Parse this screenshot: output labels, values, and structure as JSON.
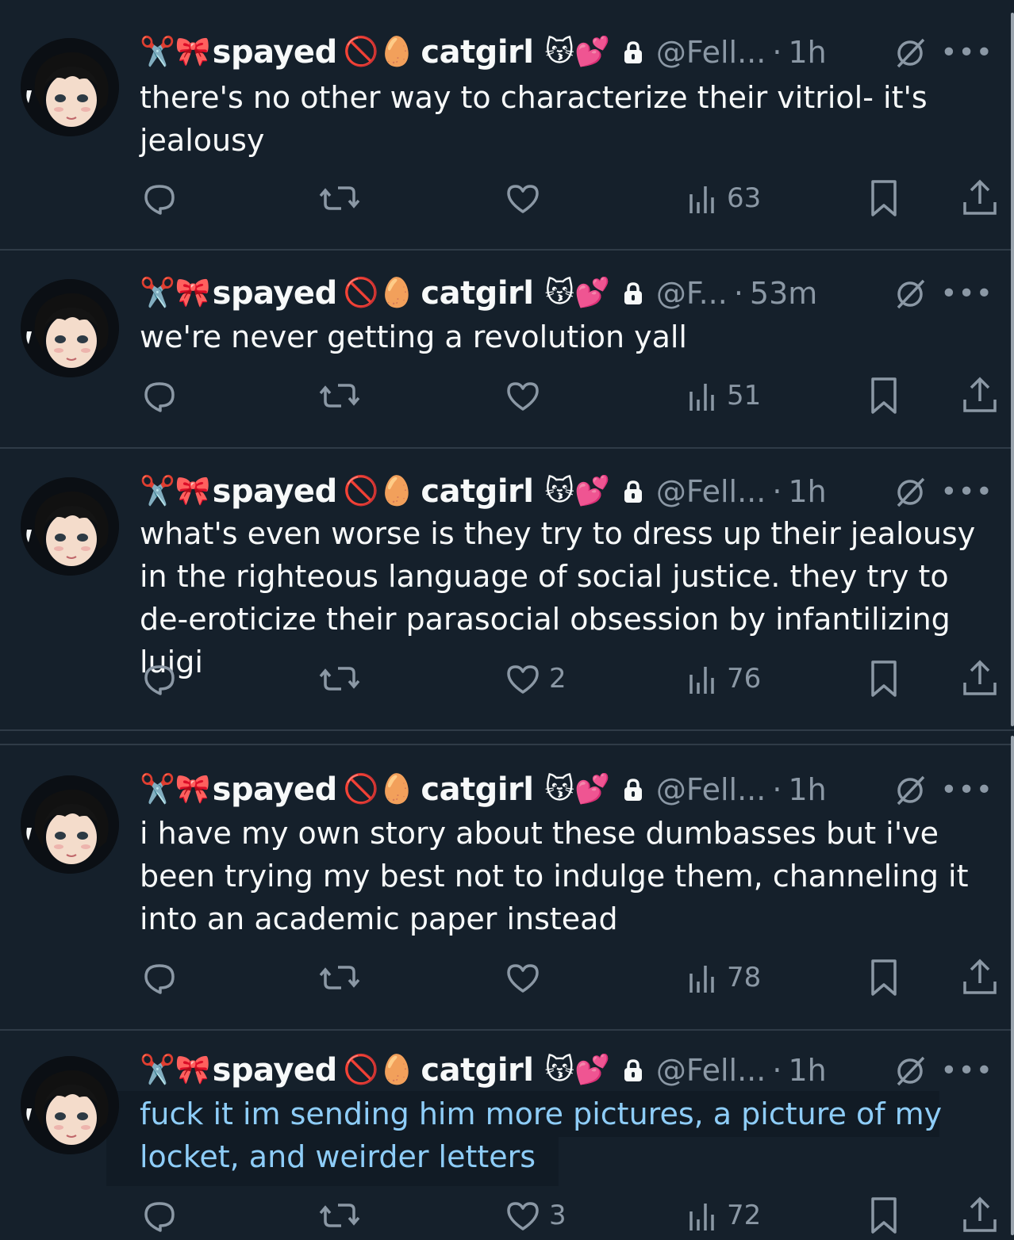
{
  "colors": {
    "background": "#15202b",
    "text": "#f7f9f9",
    "muted": "#8b98a5",
    "highlight_text": "#8ecdf8",
    "divider": "#2f3b47"
  },
  "tweets": [
    {
      "prefix_emoji": "✂️🎀",
      "name_part1": "spayed",
      "mid_emoji": "🚫🥚",
      "name_part2": "catgirl",
      "suffix_emoji": "😽💕",
      "handle": "@Fell...",
      "dot": "·",
      "time": "1h",
      "text": "there's no other way to characterize their vitriol- it's jealousy",
      "highlighted": false,
      "replies": "",
      "retweets": "",
      "likes": "",
      "views": "63"
    },
    {
      "prefix_emoji": "✂️🎀",
      "name_part1": "spayed",
      "mid_emoji": "🚫🥚",
      "name_part2": "catgirl",
      "suffix_emoji": "😽💕",
      "handle": "@F...",
      "dot": "·",
      "time": "53m",
      "text": "we're never getting a revolution yall",
      "highlighted": false,
      "replies": "",
      "retweets": "",
      "likes": "",
      "views": "51"
    },
    {
      "prefix_emoji": "✂️🎀",
      "name_part1": "spayed",
      "mid_emoji": "🚫🥚",
      "name_part2": "catgirl",
      "suffix_emoji": "😽💕",
      "handle": "@Fell...",
      "dot": "·",
      "time": "1h",
      "text": "what's even worse is they try to dress up their jealousy in the righteous language of social justice. they try to de-eroticize their parasocial obsession by infantilizing luigi",
      "highlighted": false,
      "replies": "",
      "retweets": "",
      "likes": "2",
      "views": "76"
    },
    {
      "prefix_emoji": "✂️🎀",
      "name_part1": "spayed",
      "mid_emoji": "🚫🥚",
      "name_part2": "catgirl",
      "suffix_emoji": "😽💕",
      "handle": "@Fell...",
      "dot": "·",
      "time": "1h",
      "text": "i have my own story about these dumbasses but i've been trying my best not to indulge them, channeling it into an academic paper instead",
      "highlighted": false,
      "replies": "",
      "retweets": "",
      "likes": "",
      "views": "78"
    },
    {
      "prefix_emoji": "✂️🎀",
      "name_part1": "spayed",
      "mid_emoji": "🚫🥚",
      "name_part2": "catgirl",
      "suffix_emoji": "😽💕",
      "handle": "@Fell...",
      "dot": "·",
      "time": "1h",
      "text": "fuck it im sending him more pictures, a picture of my locket, and weirder letters",
      "highlighted": true,
      "replies": "",
      "retweets": "",
      "likes": "3",
      "views": "72"
    }
  ],
  "icons": {
    "reply": "reply-icon",
    "retweet": "retweet-icon",
    "like": "heart-icon",
    "views": "views-icon",
    "bookmark": "bookmark-icon",
    "share": "share-icon",
    "lock": "lock-icon",
    "grok": "grok-icon",
    "more": "more-icon"
  }
}
